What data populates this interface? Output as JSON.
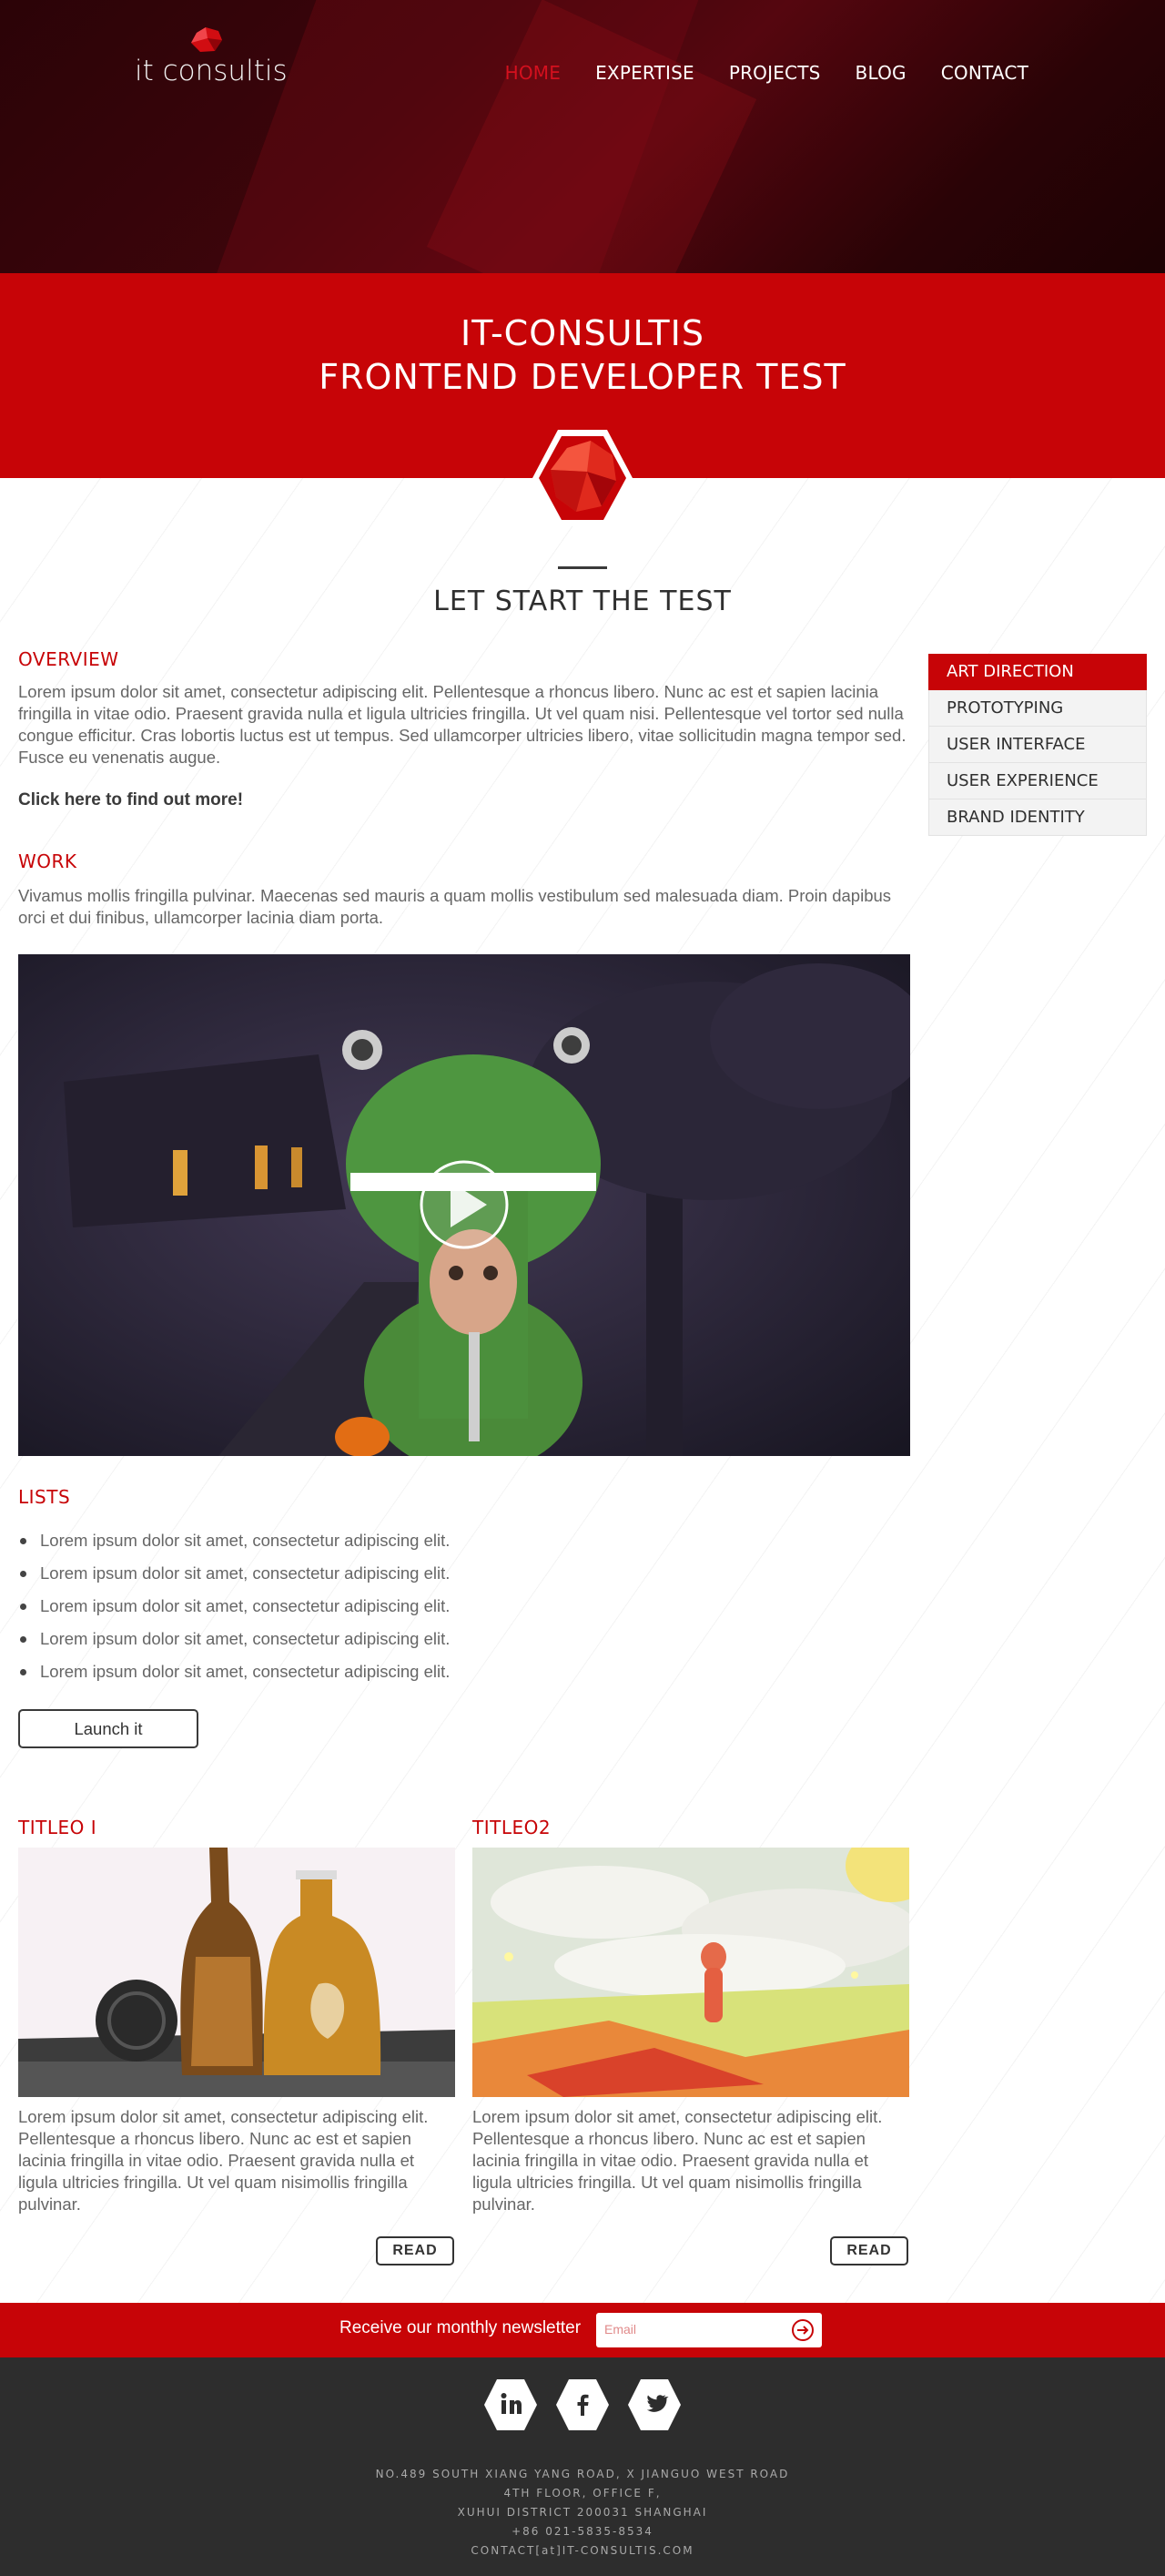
{
  "header": {
    "logo_text": "it consultis",
    "nav": [
      {
        "label": "HOME",
        "active": true
      },
      {
        "label": "EXPERTISE",
        "active": false
      },
      {
        "label": "PROJECTS",
        "active": false
      },
      {
        "label": "BLOG",
        "active": false
      },
      {
        "label": "CONTACT",
        "active": false
      }
    ]
  },
  "banner": {
    "line1": "IT-CONSULTIS",
    "line2": "FRONTEND DEVELOPER TEST"
  },
  "section_title": "LET START THE TEST",
  "overview": {
    "heading": "OVERVIEW",
    "text": "Lorem ipsum dolor sit amet, consectetur adipiscing elit. Pellentesque a rhoncus libero. Nunc ac est et sapien lacinia fringilla in vitae odio. Praesent gravida nulla et ligula ultricies fringilla. Ut vel quam nisi. Pellentesque vel tortor sed nulla congue efficitur. Cras lobortis luctus est ut tempus. Sed ullamcorper ultricies libero, vitae sollicitudin magna tempor sed. Fusce eu venenatis augue.",
    "link": "Click here to find out more!"
  },
  "work": {
    "heading": "WORK",
    "text": "Vivamus mollis fringilla pulvinar. Maecenas sed mauris a quam mollis vestibulum sed malesuada diam. Proin dapibus orci et dui finibus, ullamcorper lacinia diam porta."
  },
  "side_menu": [
    {
      "label": "ART DIRECTION",
      "active": true
    },
    {
      "label": "PROTOTYPING",
      "active": false
    },
    {
      "label": "USER INTERFACE",
      "active": false
    },
    {
      "label": "USER EXPERIENCE",
      "active": false
    },
    {
      "label": "BRAND IDENTITY",
      "active": false
    }
  ],
  "lists": {
    "heading": "LISTS",
    "items": [
      "Lorem ipsum dolor sit amet, consectetur adipiscing elit.",
      "Lorem ipsum dolor sit amet, consectetur adipiscing elit.",
      "Lorem ipsum dolor sit amet, consectetur adipiscing elit.",
      "Lorem ipsum dolor sit amet, consectetur adipiscing elit.",
      "Lorem ipsum dolor sit amet, consectetur adipiscing elit."
    ]
  },
  "launch_button": "Launch it",
  "cards": [
    {
      "title": "TITLEO I",
      "text": "Lorem ipsum dolor sit amet, consectetur adipiscing elit. Pellentesque a rhoncus libero. Nunc ac est et sapien lacinia fringilla in vitae odio. Praesent gravida nulla et ligula ultricies fringilla. Ut vel quam nisimollis fringilla pulvinar.",
      "button": "READ"
    },
    {
      "title": "TITLEO2",
      "text": "Lorem ipsum dolor sit amet, consectetur adipiscing elit. Pellentesque a rhoncus libero. Nunc ac est et sapien lacinia fringilla in vitae odio. Praesent gravida nulla et ligula ultricies fringilla. Ut vel quam nisimollis fringilla pulvinar.",
      "button": "READ"
    }
  ],
  "newsletter": {
    "label": "Receive our monthly newsletter",
    "placeholder": "Email"
  },
  "footer": {
    "social_icons": [
      "linkedin-icon",
      "facebook-icon",
      "twitter-icon"
    ],
    "address_lines": [
      "NO.489 SOUTH XIANG YANG ROAD, X JIANGUO WEST ROAD",
      "4TH FLOOR, OFFICE F,",
      "XUHUI DISTRICT 200031 SHANGHAI",
      "+86 021-5835-8534",
      "CONTACT[at]IT-CONSULTIS.COM"
    ]
  },
  "colors": {
    "brand_red": "#c70407",
    "header_dark": "#2b0307",
    "footer_dark": "#2d2d2d"
  }
}
